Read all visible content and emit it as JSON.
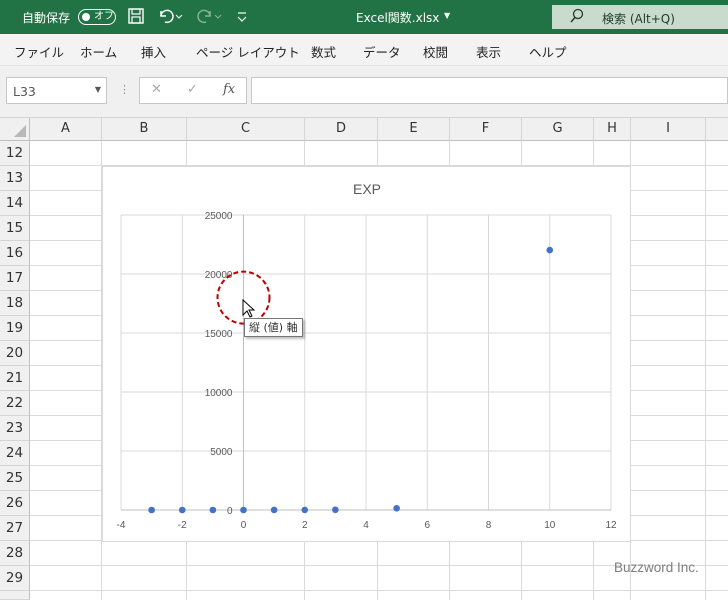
{
  "titlebar": {
    "autosave_label": "自動保存",
    "toggle_state": "オフ",
    "filename": "Excel関数.xlsx",
    "search_label": "検索 (Alt+Q)",
    "icons": [
      "save-icon",
      "undo-icon",
      "redo-icon",
      "customize-qat-icon",
      "search-icon"
    ]
  },
  "menu": {
    "items": [
      "ファイル",
      "ホーム",
      "挿入",
      "ページ レイアウト",
      "数式",
      "データ",
      "校閲",
      "表示",
      "ヘルプ"
    ]
  },
  "formula_bar": {
    "name_box": "L33",
    "formula": ""
  },
  "grid": {
    "columns": [
      "A",
      "B",
      "C",
      "D",
      "E",
      "F",
      "G",
      "H",
      "I"
    ],
    "rows": [
      "12",
      "13",
      "14",
      "15",
      "16",
      "17",
      "18",
      "19",
      "20",
      "21",
      "22",
      "23",
      "24",
      "25",
      "26",
      "27",
      "28",
      "29"
    ]
  },
  "chart_data": {
    "type": "scatter",
    "title": "EXP",
    "xlim": [
      -4,
      12
    ],
    "ylim": [
      0,
      25000
    ],
    "x_ticks": [
      -4,
      -2,
      0,
      2,
      4,
      6,
      8,
      10,
      12
    ],
    "y_ticks": [
      0,
      5000,
      10000,
      15000,
      20000,
      25000
    ],
    "x": [
      -3,
      -2,
      -1,
      0,
      1,
      2,
      3,
      5,
      10
    ],
    "y": [
      0.05,
      0.14,
      0.37,
      1,
      2.72,
      7.39,
      20.09,
      148.41,
      22026.47
    ],
    "grid": true,
    "marker_color": "#4472c4"
  },
  "tooltip": "縦 (値) 軸",
  "watermark": "Buzzword Inc."
}
